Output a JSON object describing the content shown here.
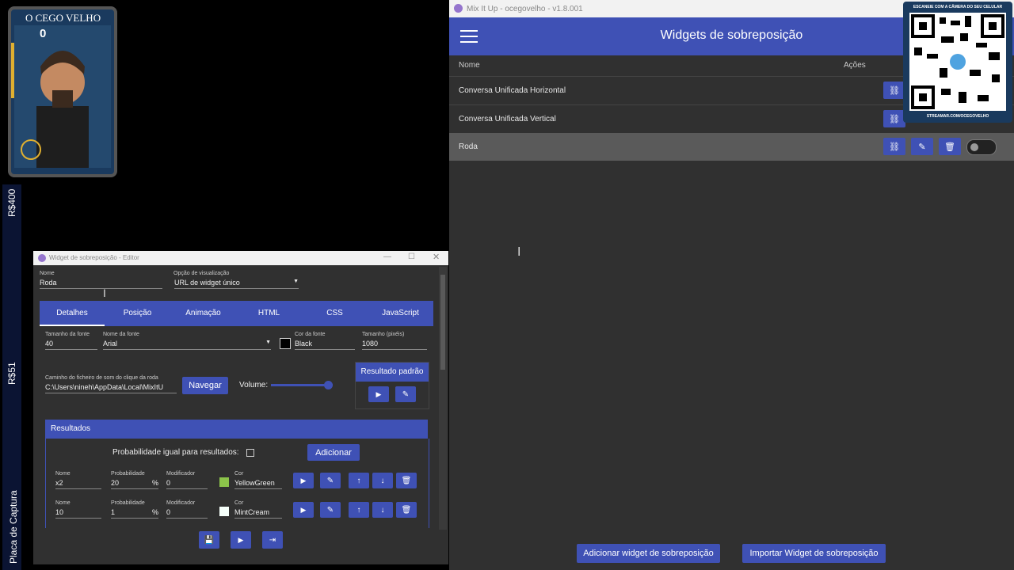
{
  "stream_overlay": {
    "cam_name": "O CEGO VELHO",
    "counter": "0",
    "side_labels": [
      "R$400",
      "R$51",
      "Placa de Captura"
    ],
    "qr": {
      "top": "ESCANEIE COM A CÂMERA DO SEU CELULAR",
      "bottom": "STREAMAR.COM/OCEGOVELHO"
    }
  },
  "main_window": {
    "title": "Mix It Up - ocegovelho - v1.8.001",
    "header_title": "Widgets de sobreposição",
    "columns": {
      "name": "Nome",
      "actions": "Ações"
    },
    "rows": [
      {
        "name": "Conversa Unificada Horizontal"
      },
      {
        "name": "Conversa Unificada Vertical"
      },
      {
        "name": "Roda"
      }
    ],
    "add_button": "Adicionar widget de sobreposição",
    "import_button": "Importar Widget de sobreposição"
  },
  "editor": {
    "title": "Widget de sobreposição - Editor",
    "name_label": "Nome",
    "name_value": "Roda",
    "view_label": "Opção de visualização",
    "view_value": "URL de widget único",
    "tabs": [
      "Detalhes",
      "Posição",
      "Animação",
      "HTML",
      "CSS",
      "JavaScript"
    ],
    "font_size_label": "Tamanho da fonte",
    "font_size_value": "40",
    "font_name_label": "Nome da fonte",
    "font_name_value": "Arial",
    "font_color_label": "Cor da fonte",
    "font_color_value": "Black",
    "size_label": "Tamanho (pixéis)",
    "size_value": "1080",
    "sound_label": "Caminho do ficheiro de som do clique da roda",
    "sound_value": "C:\\Users\\nineh\\AppData\\Local\\MixItU",
    "browse_button": "Navegar",
    "volume_label": "Volume:",
    "volume_level": 1.0,
    "default_result_label": "Resultado padrão",
    "results_header": "Resultados",
    "equal_prob_label": "Probabilidade igual para resultados:",
    "add_button": "Adicionar",
    "results": [
      {
        "name_label": "Nome",
        "name": "x2",
        "prob_label": "Probabilidade",
        "prob": "20",
        "pct": "%",
        "mod_label": "Modificador",
        "mod": "0",
        "color_label": "Cor",
        "color": "YellowGreen",
        "swatch": "#8bc34a"
      },
      {
        "name_label": "Nome",
        "name": "10",
        "prob_label": "Probabilidade",
        "prob": "1",
        "pct": "%",
        "mod_label": "Modificador",
        "mod": "0",
        "color_label": "Cor",
        "color": "MintCream",
        "swatch": "#f5fffa"
      }
    ]
  },
  "colors": {
    "accent": "#3f51b5",
    "bg": "#303030"
  }
}
